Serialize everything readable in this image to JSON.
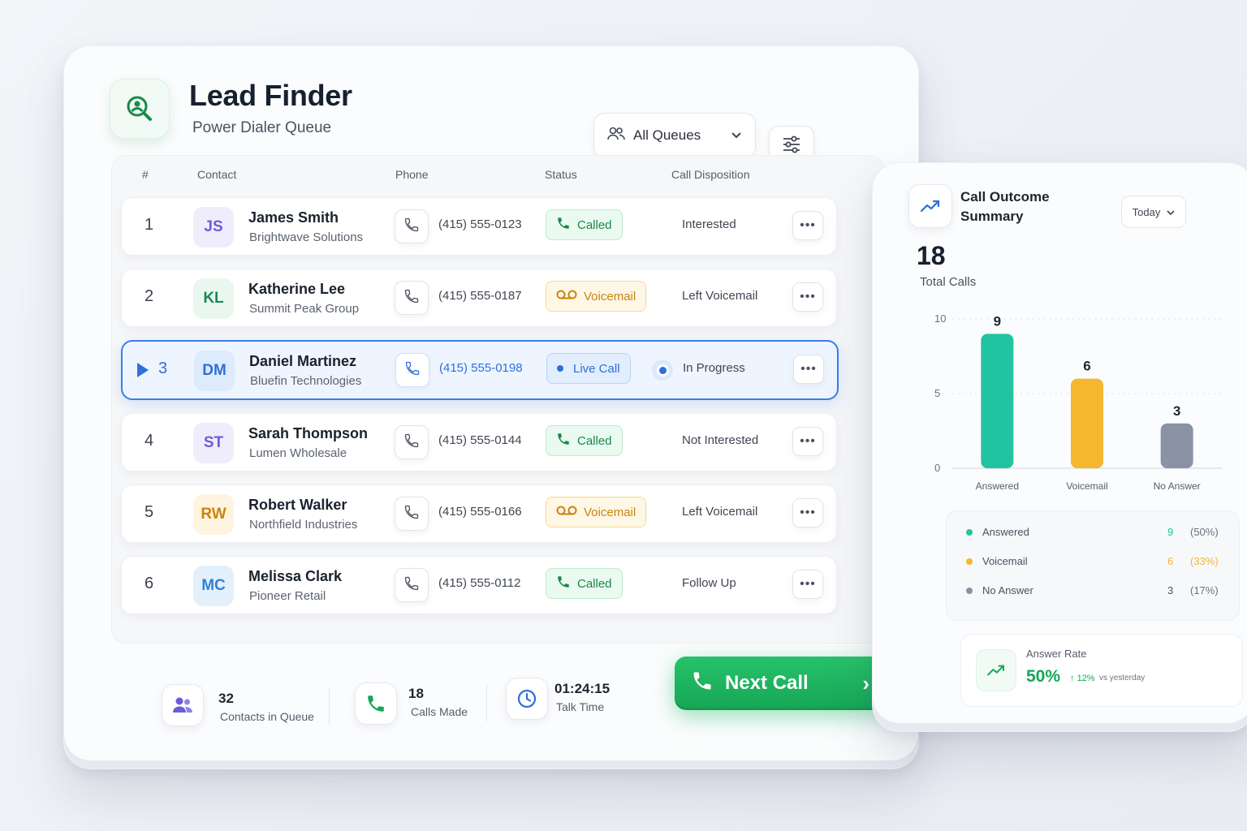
{
  "app": {
    "title": "Lead Finder",
    "subtitle": "Power Dialer Queue"
  },
  "toolbar": {
    "queue_select": "All Queues",
    "filter_icon": "sliders-icon"
  },
  "table": {
    "headers": {
      "num": "#",
      "contact": "Contact",
      "phone": "Phone",
      "status": "Status",
      "disposition": "Call Disposition"
    },
    "rows": [
      {
        "num": "1",
        "initials": "JS",
        "name": "James Smith",
        "company": "Brightwave Solutions",
        "phone": "(415) 555-0123",
        "status": "Called",
        "status_type": "called",
        "disposition": "Interested",
        "avatar_color": "#6a5cd6",
        "avatar_bg": "#efedfc"
      },
      {
        "num": "2",
        "initials": "KL",
        "name": "Katherine Lee",
        "company": "Summit Peak Group",
        "phone": "(415) 555-0187",
        "status": "Voicemail",
        "status_type": "voicemail",
        "disposition": "Left Voicemail",
        "avatar_color": "#1a8a52",
        "avatar_bg": "#eaf7ef"
      },
      {
        "num": "3",
        "initials": "DM",
        "name": "Daniel Martinez",
        "company": "Bluefin Technologies",
        "phone": "(415) 555-0198",
        "status": "Live Call",
        "status_type": "live",
        "disposition": "In Progress",
        "avatar_color": "#2f6fdb",
        "avatar_bg": "#deebfc",
        "active": true
      },
      {
        "num": "4",
        "initials": "ST",
        "name": "Sarah Thompson",
        "company": "Lumen Wholesale",
        "phone": "(415) 555-0144",
        "status": "Called",
        "status_type": "called",
        "disposition": "Not Interested",
        "avatar_color": "#6a5cd6",
        "avatar_bg": "#efedfc"
      },
      {
        "num": "5",
        "initials": "RW",
        "name": "Robert Walker",
        "company": "Northfield Industries",
        "phone": "(415) 555-0166",
        "status": "Voicemail",
        "status_type": "voicemail",
        "disposition": "Left Voicemail",
        "avatar_color": "#c98410",
        "avatar_bg": "#fff4df"
      },
      {
        "num": "6",
        "initials": "MC",
        "name": "Melissa Clark",
        "company": "Pioneer Retail",
        "phone": "(415) 555-0112",
        "status": "Called",
        "status_type": "called",
        "disposition": "Follow Up",
        "avatar_color": "#2f7fd0",
        "avatar_bg": "#e3f0fc"
      }
    ]
  },
  "footer": {
    "queue": {
      "value": "32",
      "label": "Contacts in Queue"
    },
    "calls": {
      "value": "18",
      "label": "Calls Made"
    },
    "talk": {
      "value": "01:24:15",
      "label": "Talk Time"
    },
    "next_call": "Next Call"
  },
  "summary": {
    "title": "Call Outcome Summary",
    "period": "Today",
    "total_value": "18",
    "total_label": "Total Calls",
    "legend": [
      {
        "label": "Answered",
        "value": "9",
        "pct": "(50%)",
        "color": "#22c3a0"
      },
      {
        "label": "Voicemail",
        "value": "6",
        "pct": "(33%)",
        "color": "#f5b630"
      },
      {
        "label": "No Answer",
        "value": "3",
        "pct": "(17%)",
        "color": "#8a92a6"
      }
    ],
    "answer_rate": {
      "label": "Answer Rate",
      "value": "50%",
      "delta": "12%",
      "vs": "vs yesterday"
    }
  },
  "chart_data": {
    "type": "bar",
    "categories": [
      "Answered",
      "Voicemail",
      "No Answer"
    ],
    "values": [
      9,
      6,
      3
    ],
    "ylim": [
      0,
      10
    ],
    "yticks": [
      0,
      5,
      10
    ],
    "colors": [
      "#22c3a0",
      "#f5b630",
      "#8a92a6"
    ],
    "grid": true
  },
  "colors": {
    "accent": "#2f6fdb",
    "success": "#16a656",
    "warning": "#f5b630"
  }
}
